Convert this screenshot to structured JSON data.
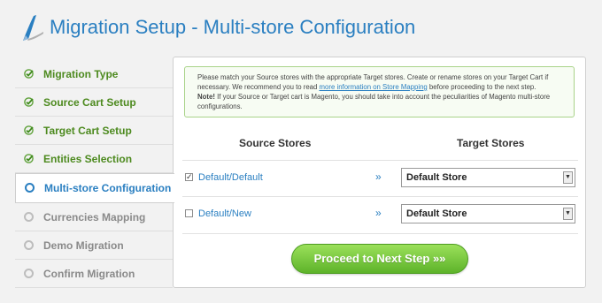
{
  "header": {
    "title": "Migration Setup - Multi-store Configuration",
    "logo_icon": "arrow-logo-icon"
  },
  "sidebar": {
    "items": [
      {
        "label": "Migration Type",
        "state": "done"
      },
      {
        "label": "Source Cart Setup",
        "state": "done"
      },
      {
        "label": "Target Cart Setup",
        "state": "done"
      },
      {
        "label": "Entities Selection",
        "state": "done"
      },
      {
        "label": "Multi-store Configuration",
        "state": "active"
      },
      {
        "label": "Currencies Mapping",
        "state": "pending"
      },
      {
        "label": "Demo Migration",
        "state": "pending"
      },
      {
        "label": "Confirm Migration",
        "state": "pending"
      }
    ]
  },
  "notice": {
    "line1_before": "Please match your Source stores with the appropriate Target stores. Create or rename stores on your Target Cart if necessary. We recommend you to read ",
    "link": "more information on Store Mapping",
    "line1_after": " before proceeding to the next step.",
    "note_label": "Note!",
    "note_text": " If your Source or Target cart is Magento, you should take into account the peculiarities of Magento multi-store configurations."
  },
  "table": {
    "source_header": "Source Stores",
    "target_header": "Target Stores",
    "rows": [
      {
        "source": "Default/Default",
        "checked": true,
        "arrow": "»",
        "target": "Default Store"
      },
      {
        "source": "Default/New",
        "checked": false,
        "arrow": "»",
        "target": "Default Store"
      }
    ]
  },
  "proceed_button": {
    "label": "Proceed to Next Step »»"
  },
  "colors": {
    "accent": "#2a7fc1",
    "done": "#4d8a1f",
    "button": "#6cbf35"
  }
}
